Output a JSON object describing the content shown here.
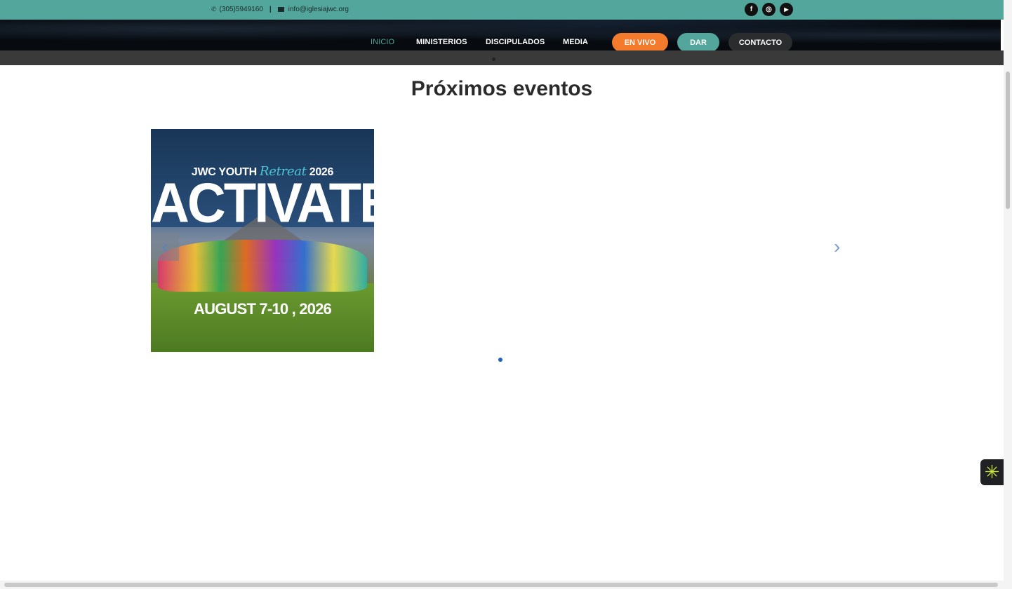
{
  "topbar": {
    "phone_icon": "phone-icon",
    "phone": "(305)5949160",
    "separator": "|",
    "email_icon": "envelope-icon",
    "email": "info@iglesiajwc.org",
    "social": [
      {
        "icon": "facebook-icon",
        "glyph": "f"
      },
      {
        "icon": "instagram-icon",
        "glyph": "◎"
      },
      {
        "icon": "youtube-icon",
        "glyph": "▶"
      }
    ]
  },
  "nav": {
    "links": [
      "INICIO",
      "MINISTERIOS",
      "DISCIPULADOS",
      "MEDIA"
    ],
    "live_button": "EN VIVO",
    "give_button": "DAR",
    "contact_button": "CONTACTO",
    "active_color": "#52a69b",
    "live_color": "#f47a2c"
  },
  "main": {
    "title": "Próximos eventos",
    "event": {
      "line1": "JWC YOUTH",
      "script": "Retreat",
      "year": "2026",
      "headline": "ACTIVATE",
      "dates": "AUGUST 7-10 , 2026"
    },
    "prev_arrow": "‹",
    "next_arrow": "›"
  },
  "widget": {
    "icon": "asterisk-icon",
    "glyph": "✳"
  }
}
